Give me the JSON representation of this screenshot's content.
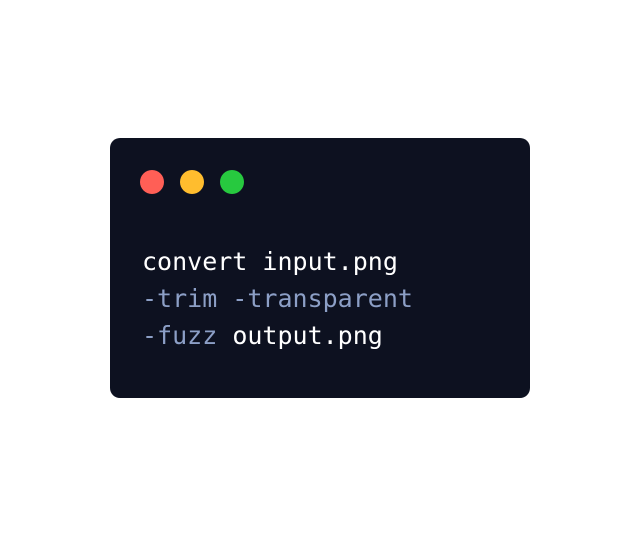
{
  "window": {
    "buttons": [
      {
        "name": "close",
        "color": "#ff5f56"
      },
      {
        "name": "minimize",
        "color": "#ffbd2e"
      },
      {
        "name": "zoom",
        "color": "#27c93f"
      }
    ]
  },
  "code": {
    "colors": {
      "text": "#ffffff",
      "flag": "#8c9fc6",
      "background": "#0d1120"
    },
    "lines": [
      [
        {
          "text": "convert input.png",
          "kind": "plain"
        }
      ],
      [
        {
          "text": "-trim -transparent",
          "kind": "flag"
        }
      ],
      [
        {
          "text": "-fuzz",
          "kind": "flag"
        },
        {
          "text": " output.png",
          "kind": "plain"
        }
      ]
    ]
  }
}
